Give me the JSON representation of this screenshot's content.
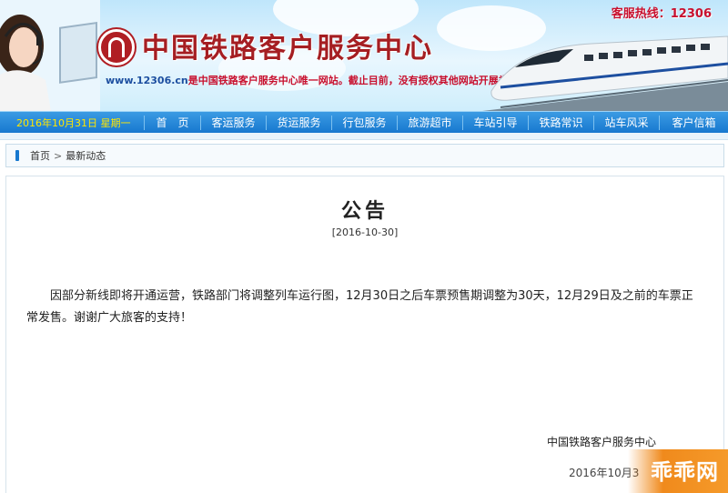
{
  "header": {
    "hotline_label": "客服热线：",
    "hotline_number": "12306",
    "site_title": "中国铁路客户服务中心",
    "notice_url": "www.12306.cn",
    "notice_text": "是中国铁路客户服务中心唯一网站。截止目前，没有授权其他网站开展类似服务内容。"
  },
  "nav": {
    "date": "2016年10月31日 星期一",
    "items": [
      {
        "label": "首　页"
      },
      {
        "label": "客运服务"
      },
      {
        "label": "货运服务"
      },
      {
        "label": "行包服务"
      },
      {
        "label": "旅游超市"
      },
      {
        "label": "车站引导"
      },
      {
        "label": "铁路常识"
      },
      {
        "label": "站车风采"
      },
      {
        "label": "客户信箱"
      }
    ]
  },
  "breadcrumb": {
    "home": "首页",
    "separator": ">",
    "current": "最新动态"
  },
  "notice": {
    "title": "公告",
    "date": "[2016-10-30]",
    "body": "因部分新线即将开通运营，铁路部门将调整列车运行图，12月30日之后车票预售期调整为30天，12月29日及之前的车票正常发售。谢谢广大旅客的支持！",
    "signature": "中国铁路客户服务中心",
    "sign_date": "2016年10月3"
  },
  "watermark": {
    "text": "乖乖网"
  },
  "colors": {
    "brand_red": "#a51e22",
    "nav_blue": "#1778cf",
    "nav_date_yellow": "#ffe600"
  }
}
